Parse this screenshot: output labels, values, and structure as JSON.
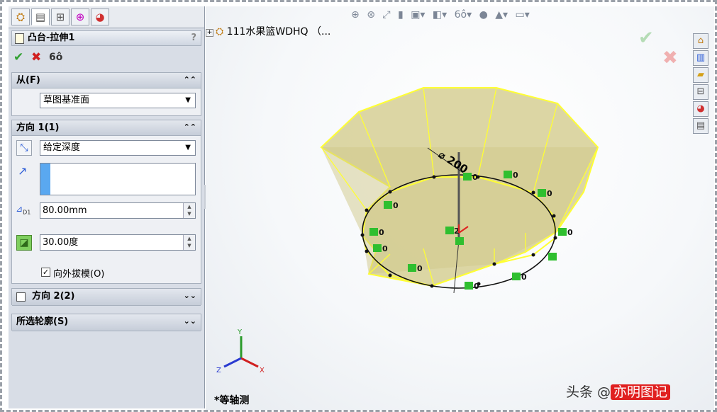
{
  "panel": {
    "tabs": [
      "feature-manager-icon",
      "property-manager-icon",
      "configuration-manager-icon",
      "dimxpert-icon",
      "display-manager-icon"
    ],
    "title": "凸台-拉伸1",
    "help": "?",
    "from": {
      "header": "从(F)",
      "value": "草图基准面"
    },
    "direction1": {
      "header": "方向 1(1)",
      "end_condition": "给定深度",
      "depth": "80.00mm",
      "draft_angle": "30.00度",
      "draft_outward_label": "向外拔模(O)",
      "draft_outward_checked": true
    },
    "direction2": {
      "header": "方向 2(2)",
      "checked": false
    },
    "selected_contours": {
      "header": "所选轮廓(S)"
    }
  },
  "viewport": {
    "tree_root": "111水果篮WDHQ （...",
    "view_label": "*等轴测",
    "dimension_label": "⌀ 200",
    "relation_label": "0",
    "origin_label": "2",
    "axes": {
      "x": "X",
      "y": "Y",
      "z": "Z"
    },
    "watermark_prefix": "头条 @",
    "watermark_name": "亦明图记"
  },
  "colors": {
    "accent": "#2a5bd7",
    "ok": "#2fa02f",
    "cancel": "#d02020",
    "body_fill": "#d9d39a",
    "edge": "#ffff33"
  }
}
